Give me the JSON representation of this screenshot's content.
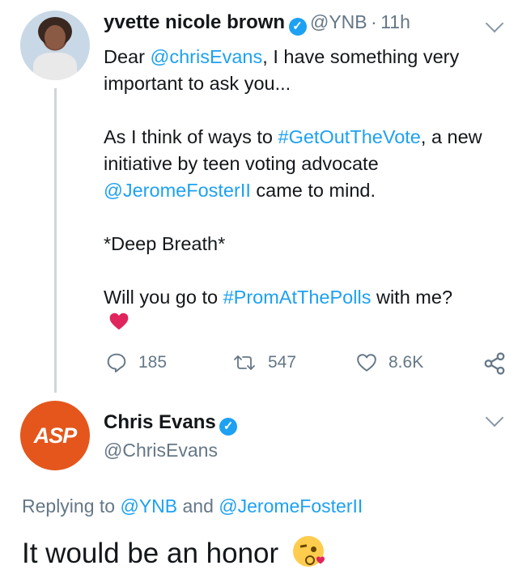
{
  "tweet": {
    "author_name": "yvette nicole brown",
    "author_handle": "@YNB",
    "separator": "·",
    "time": "11h",
    "line1_prefix": "Dear ",
    "line1_mention": "@chrisEvans",
    "line1_suffix": ", I have something very important to ask you...",
    "para2_prefix": "As I think of ways to ",
    "para2_hashtag": "#GetOutTheVote",
    "para2_middle": ", a new initiative by teen voting advocate ",
    "para2_mention": "@JeromeFosterII",
    "para2_suffix": " came to mind.",
    "para3": "*Deep Breath*",
    "para4_prefix": "Will you go to ",
    "para4_hashtag": "#PromAtThePolls",
    "para4_suffix": " with me?",
    "emoji": "red-heart",
    "replies": "185",
    "retweets": "547",
    "likes": "8.6K"
  },
  "reply_tweet": {
    "author_name": "Chris Evans",
    "author_handle": "@ChrisEvans",
    "avatar_text": "ASP",
    "replying_prefix": "Replying to ",
    "replying_to_1": "@YNB",
    "replying_and": " and ",
    "replying_to_2": "@JeromeFosterII",
    "text": "It would be an honor",
    "emoji": "face-blowing-a-kiss"
  },
  "colors": {
    "link": "#1da1f2",
    "secondary_text": "#657786",
    "heart": "#e0245e",
    "asp_logo": "#e4561c"
  }
}
